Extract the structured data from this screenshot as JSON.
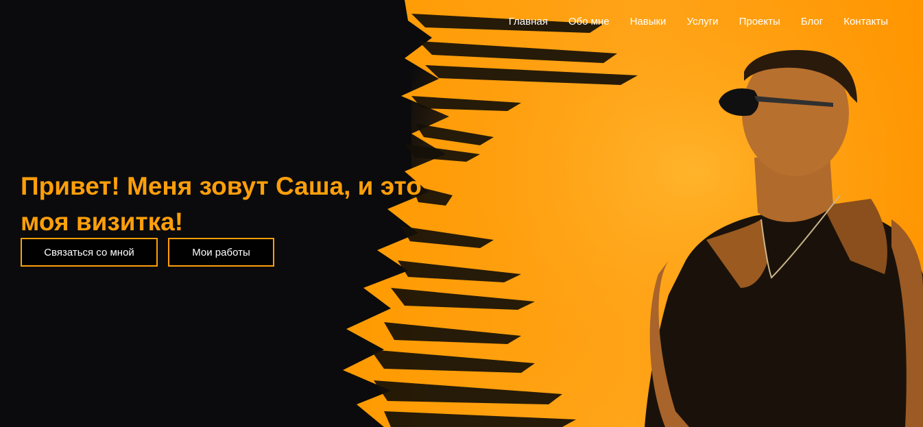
{
  "nav": {
    "items": [
      "Главная",
      "Обо мне",
      "Навыки",
      "Услуги",
      "Проекты",
      "Блог",
      "Контакты"
    ]
  },
  "hero": {
    "headline": "Привет! Меня зовут Саша, и это моя визитка!",
    "contact_button": "Связаться со мной",
    "works_button": "Мои работы"
  },
  "colors": {
    "accent": "#ff9f0a",
    "background": "#0b0b0d"
  }
}
